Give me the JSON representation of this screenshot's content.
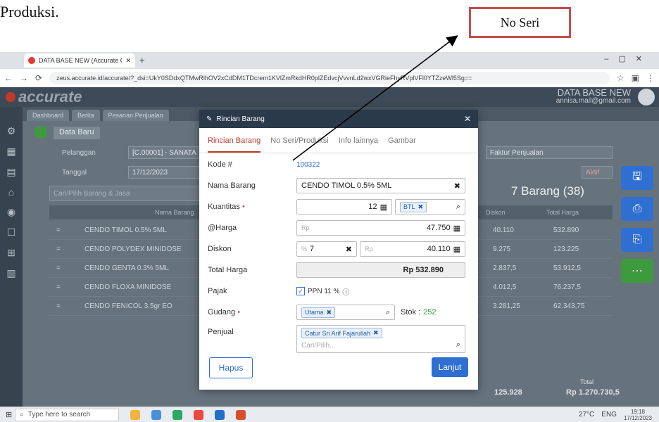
{
  "document": {
    "text": "Produksi.",
    "callout": "No Seri"
  },
  "browser": {
    "tab_title": "DATA BASE NEW (Accurate On",
    "url": "zeus.accurate.id/accurate/?_dsi=UkY0SDdxQTMwRlhOV2xCdDM1TDcrem1KVlZmRkdHR0plZEdvcjVvvnLd2wxVGRieFhyRVplVFl0YTZzeWl5Sg=="
  },
  "app": {
    "brand": "accurate",
    "db_name": "DATA BASE NEW",
    "db_email": "annisa.mail@gmail.com",
    "nav_tabs": [
      "Dashboard",
      "Berita",
      "Pesanan Penjualan"
    ],
    "data_tab": "Data Baru",
    "fields": {
      "pelanggan_label": "Pelanggan",
      "pelanggan_value": "[C.00001] - SANATA",
      "tanggal_label": "Tanggal",
      "tanggal_value": "17/12/2023",
      "faktur_label": "Faktur Penjualan",
      "aktif_label": "Aktif"
    },
    "search_placeholder": "Cari/Pilih Barang & Jasa",
    "item_count": "7 Barang (38)",
    "table": {
      "headers": [
        "Nama Barang",
        "Diskon",
        "Total Harga"
      ],
      "rows": [
        {
          "name": "CENDO TIMOL 0.5% 5ML",
          "diskon": "40.110",
          "total": "532.890"
        },
        {
          "name": "CENDO POLYDEX MINIDOSE",
          "diskon": "9.275",
          "total": "123.225"
        },
        {
          "name": "CENDO GENTA 0.3% 5ML",
          "diskon": "2.837,5",
          "total": "53.912,5"
        },
        {
          "name": "CENDO FLOXA MINIDOSE",
          "diskon": "4.012,5",
          "total": "76.237,5"
        },
        {
          "name": "CENDO FENICOL 3.5gr EO",
          "diskon": "3.281,25",
          "total": "62.343,75"
        }
      ]
    },
    "summary": {
      "subtotal": "125.928",
      "total_label": "Total",
      "total_value": "Rp 1.270.730,5"
    }
  },
  "modal": {
    "title": "Rincian Barang",
    "tabs": [
      "Rincian Barang",
      "No Seri/Produksi",
      "Info lainnya",
      "Gambar"
    ],
    "kode_label": "Kode #",
    "kode_value": "100322",
    "nama_label": "Nama Barang",
    "nama_value": "CENDO TIMOL 0.5% 5ML",
    "kuantitas_label": "Kuantitas",
    "kuantitas_value": "12",
    "unit": "BTL",
    "harga_label": "@Harga",
    "harga_prefix": "Rp",
    "harga_value": "47.750",
    "diskon_label": "Diskon",
    "diskon_pct_prefix": "%",
    "diskon_pct": "7",
    "diskon_amount_prefix": "Rp",
    "diskon_amount": "40.110",
    "total_label": "Total Harga",
    "total_value": "Rp 532.890",
    "pajak_label": "Pajak",
    "pajak_value": "PPN 11 %",
    "gudang_label": "Gudang",
    "gudang_value": "Utama",
    "stok_label": "Stok :",
    "stok_value": "252",
    "penjual_label": "Penjual",
    "penjual_value": "Catur Sri Arif Fajarullah",
    "penjual_placeholder": "Cari/Pilih...",
    "hapus": "Hapus",
    "lanjut": "Lanjut"
  },
  "taskbar": {
    "search": "Type here to search",
    "weather": "27°C",
    "lang": "ENG",
    "time": "19:18",
    "date": "17/12/2023"
  }
}
